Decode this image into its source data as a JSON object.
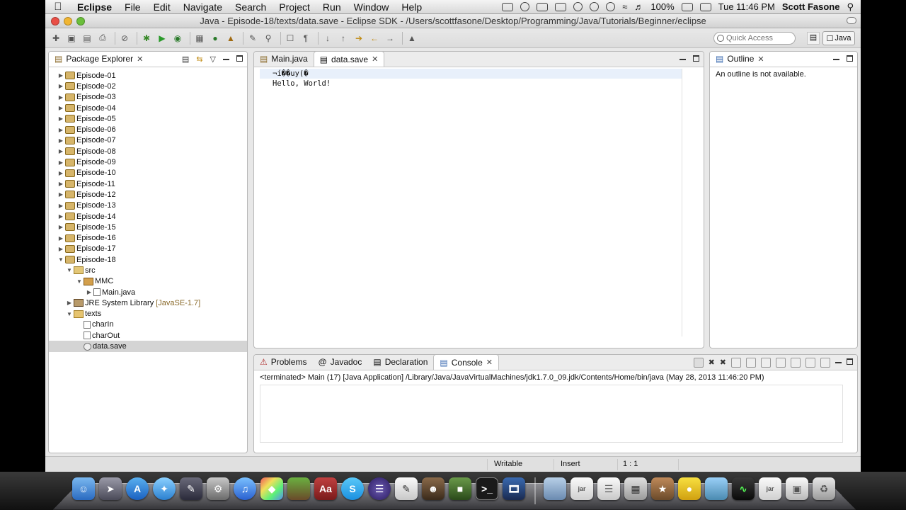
{
  "menubar": {
    "app_name": "Eclipse",
    "items": [
      "File",
      "Edit",
      "Navigate",
      "Search",
      "Project",
      "Run",
      "Window",
      "Help"
    ],
    "battery": "100%",
    "clock": "Tue 11:46 PM",
    "user": "Scott Fasone"
  },
  "window": {
    "title": "Java - Episode-18/texts/data.save - Eclipse SDK - /Users/scottfasone/Desktop/Programming/Java/Tutorials/Beginner/eclipse"
  },
  "toolbar": {
    "quick_access_placeholder": "Quick Access",
    "perspective": "Java"
  },
  "package_explorer": {
    "tab_label": "Package Explorer",
    "episodes": [
      "Episode-01",
      "Episode-02",
      "Episode-03",
      "Episode-04",
      "Episode-05",
      "Episode-06",
      "Episode-07",
      "Episode-08",
      "Episode-09",
      "Episode-10",
      "Episode-11",
      "Episode-12",
      "Episode-13",
      "Episode-14",
      "Episode-15",
      "Episode-16",
      "Episode-17"
    ],
    "open_project": "Episode-18",
    "src": "src",
    "package": "MMC",
    "main_file": "Main.java",
    "jre_label": "JRE System Library",
    "jre_version": "[JavaSE-1.7]",
    "texts_folder": "texts",
    "files": [
      "charIn",
      "charOut",
      "data.save"
    ],
    "selected_file": "data.save"
  },
  "editor": {
    "tabs": [
      {
        "label": "Main.java",
        "active": false
      },
      {
        "label": "data.save",
        "active": true
      }
    ],
    "lines": [
      "¬í��uy(�",
      "Hello, World!"
    ]
  },
  "outline": {
    "tab_label": "Outline",
    "message": "An outline is not available."
  },
  "bottom_panel": {
    "tabs": [
      "Problems",
      "Javadoc",
      "Declaration",
      "Console"
    ],
    "active_tab": "Console",
    "console_header": "<terminated> Main (17) [Java Application] /Library/Java/JavaVirtualMachines/jdk1.7.0_09.jdk/Contents/Home/bin/java (May 28, 2013 11:46:20 PM)"
  },
  "statusbar": {
    "writable": "Writable",
    "insert": "Insert",
    "position": "1 : 1"
  },
  "colors": {
    "menubar": "#dcdcdc",
    "selection": "#d4d4d4",
    "current_line": "#e8f0fb",
    "jre_version": "#8a6a2a"
  }
}
